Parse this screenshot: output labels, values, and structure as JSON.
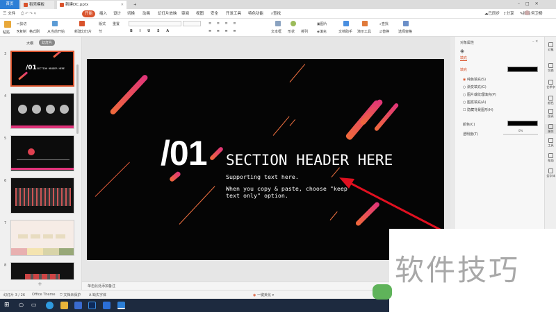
{
  "tabs": {
    "home": "首页",
    "daoke": "稻壳模板",
    "file": "新建DC.pptx",
    "add": "+"
  },
  "menu": {
    "file": "三 文件",
    "start": "开始",
    "insert": "插入",
    "design": "设计",
    "transition": "切换",
    "animation": "动画",
    "slideshow": "幻灯片放映",
    "review": "审阅",
    "view": "视图",
    "security": "安全",
    "devtools": "开发工具",
    "special": "特色功能",
    "search": "查找",
    "sync": "已同步",
    "share": "分享",
    "comment": "批注",
    "user": "何卫杨"
  },
  "ribbon": {
    "paste": "粘贴",
    "cut": "剪切",
    "copy": "复制",
    "format_painter": "格式刷",
    "from_current": "从当前开始",
    "new_slide": "新建幻灯片",
    "layout": "版式",
    "section": "节",
    "reset": "重置",
    "text_box": "文本框",
    "shape": "形状",
    "arrange": "排列",
    "image": "图片",
    "fill": "填充",
    "outline": "轮廓",
    "doc_assistant": "文档助手",
    "presenter_tools": "演示工具",
    "find": "查找",
    "replace": "替换",
    "select_pane": "选择窗格"
  },
  "left_pane": {
    "outline_tab": "大纲",
    "slides_tab": "幻灯片",
    "slide_numbers": [
      "3",
      "4",
      "5",
      "6",
      "7",
      "8"
    ]
  },
  "slide": {
    "number_tag": "/01",
    "header": "SECTION HEADER HERE",
    "supporting": "Supporting text here.",
    "note_line1": "When you copy & paste, choose \"keep",
    "note_line2": "text only\" option."
  },
  "notes_placeholder": "单击此处添加备注",
  "right_panel": {
    "title": "对象属性",
    "tab_fill": "填充",
    "fill_label": "填充",
    "options": [
      "纯色填充(S)",
      "渐变填充(G)",
      "图片或纹理填充(P)",
      "图案填充(A)"
    ],
    "hide_bg": "隐藏背景图形(H)",
    "color_label": "颜色(C)",
    "transparency_label": "透明度(T)",
    "transparency_value": "0%"
  },
  "right_bar": [
    "对象",
    "切换",
    "艺术字",
    "颜色",
    "图表",
    "属性",
    "工具",
    "帮助",
    "云字体"
  ],
  "status": {
    "slide_pos": "幻灯片 3 / 26",
    "theme": "Office Theme",
    "protect": "文档未保护",
    "missing_font": "缺失字体",
    "beautify": "一键美化"
  },
  "watermark": "软件技巧",
  "colors": {
    "accent": "#d9532c",
    "slide_bg": "#050505",
    "stripe_start": "#f06a3a",
    "stripe_end": "#e0337a",
    "arrow": "#e01020"
  }
}
